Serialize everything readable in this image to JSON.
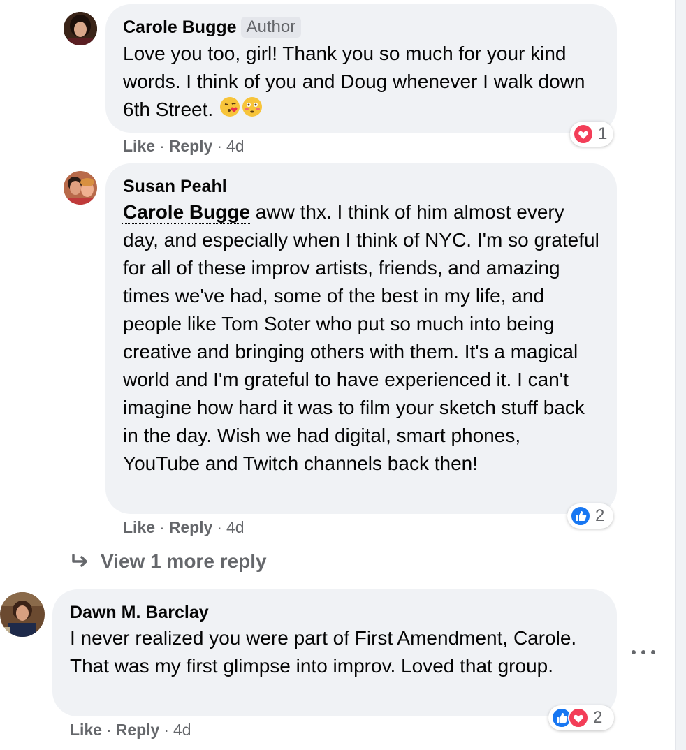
{
  "comments": [
    {
      "author": "Carole Bugge",
      "badge": "Author",
      "text": "Love you too, girl! Thank you so much for your kind words. I think of you and Doug whenever I walk down 6th Street.",
      "like_label": "Like",
      "reply_label": "Reply",
      "time": "4d",
      "reaction_count": "1",
      "reaction_types": [
        "love"
      ]
    },
    {
      "author": "Susan Peahl",
      "mention": "Carole Bugge",
      "text": " aww thx. I think of him almost every day, and especially when I think of NYC. I'm so grateful for all of these improv artists, friends, and amazing times we've had, some of the best in my life, and people like Tom Soter who put so much into being creative and bringing others with them. It's a magical world and I'm grateful to have experienced it. I can't imagine how hard it was to film your sketch stuff back in the day. Wish we had digital, smart phones, YouTube and Twitch channels back then!",
      "like_label": "Like",
      "reply_label": "Reply",
      "time": "4d",
      "reaction_count": "2",
      "reaction_types": [
        "like"
      ]
    },
    {
      "author": "Dawn M. Barclay",
      "text": "I never realized you were part of First Amendment, Carole. That was my first glimpse into improv. Loved that group.",
      "like_label": "Like",
      "reply_label": "Reply",
      "time": "4d",
      "reaction_count": "2",
      "reaction_types": [
        "like",
        "love"
      ]
    }
  ],
  "view_more_replies": "View 1 more reply",
  "icons": {
    "emojis_comment1": [
      "kissing-face-heart-emoji",
      "flushed-face-emoji"
    ],
    "reply_arrow": "reply-arrow-icon",
    "more": "more-options-icon"
  },
  "colors": {
    "bubble": "#f0f2f5",
    "secondary_text": "#65676b",
    "like_blue": "#1877f2",
    "love_red": "#f33e58"
  }
}
